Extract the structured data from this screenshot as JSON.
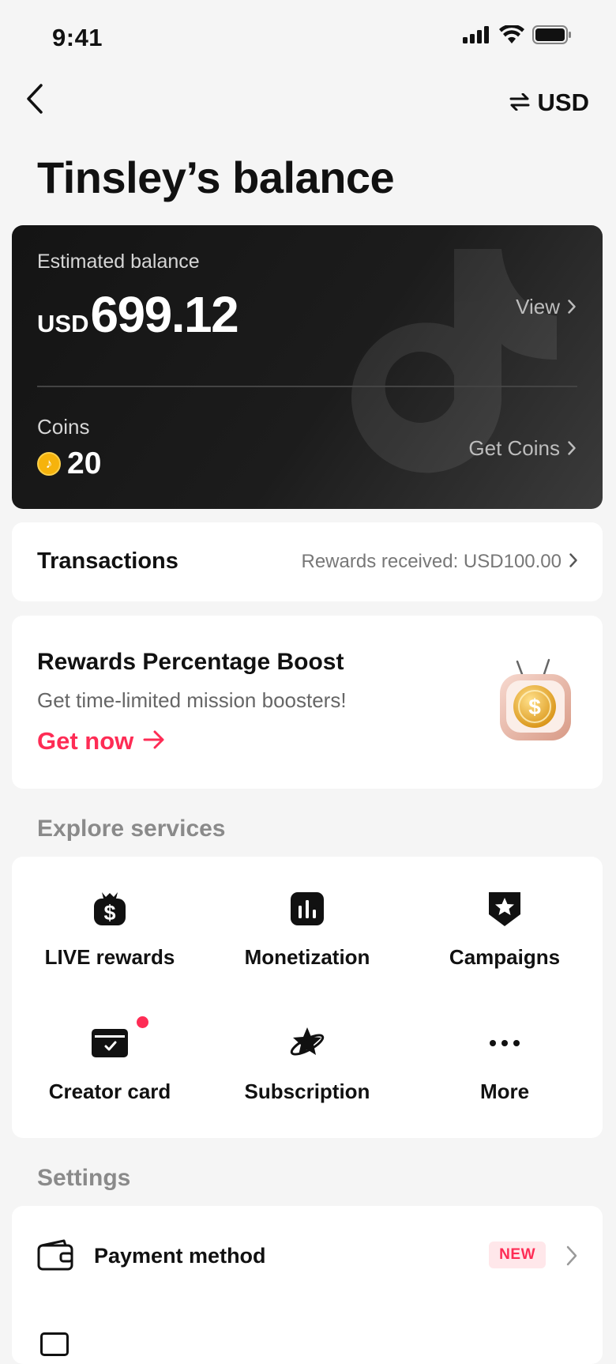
{
  "status_bar": {
    "time": "9:41",
    "icons": [
      "signal-icon",
      "wifi-icon",
      "battery-icon"
    ]
  },
  "nav": {
    "back_icon": "chevron-left-icon",
    "currency_switch_icon": "swap-arrows-icon",
    "currency": "USD"
  },
  "page_title": "Tinsley’s balance",
  "balance_card": {
    "estimated_label": "Estimated balance",
    "currency": "USD",
    "amount": "699.12",
    "view_label": "View",
    "coins_label": "Coins",
    "coins_value": "20",
    "get_coins_label": "Get Coins"
  },
  "transactions": {
    "label": "Transactions",
    "rewards_text": "Rewards received: USD100.00"
  },
  "boost": {
    "title": "Rewards Percentage Boost",
    "subtitle": "Get time-limited mission boosters!",
    "cta": "Get now"
  },
  "explore": {
    "label": "Explore services",
    "items": [
      {
        "label": "LIVE rewards",
        "icon": "money-bag-icon"
      },
      {
        "label": "Monetization",
        "icon": "bar-chart-icon"
      },
      {
        "label": "Campaigns",
        "icon": "star-badge-icon"
      },
      {
        "label": "Creator card",
        "icon": "card-check-icon",
        "has_notification": true
      },
      {
        "label": "Subscription",
        "icon": "planet-star-icon"
      },
      {
        "label": "More",
        "icon": "more-dots-icon"
      }
    ]
  },
  "settings": {
    "label": "Settings",
    "payment_method": {
      "label": "Payment method",
      "badge": "NEW"
    }
  },
  "colors": {
    "accent": "#fe2c55",
    "card_dark": "#161616",
    "background": "#f5f5f5"
  }
}
